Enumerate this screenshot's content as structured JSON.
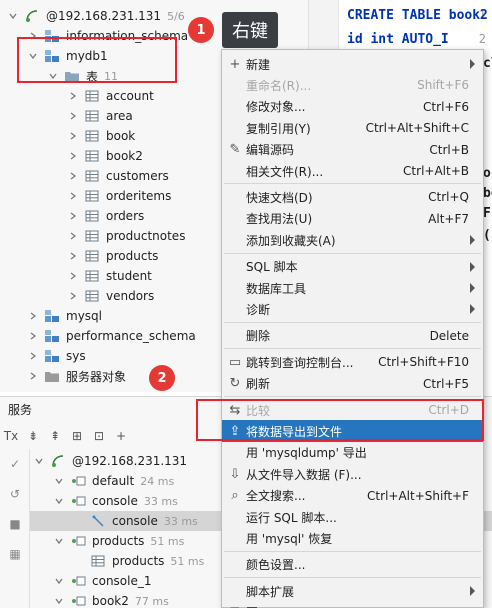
{
  "tree": {
    "connection": {
      "label": "@192.168.231.131",
      "count": "5/6"
    },
    "schemas_top": [
      {
        "label": "information_schema"
      }
    ],
    "mydb": {
      "label": "mydb1"
    },
    "tables_folder": {
      "label": "表",
      "count": "11"
    },
    "tables": [
      "account",
      "area",
      "book",
      "book2",
      "customers",
      "orderitems",
      "orders",
      "productnotes",
      "products",
      "student",
      "vendors"
    ],
    "schemas_bottom": [
      "mysql",
      "performance_schema",
      "sys"
    ],
    "server_objects": "服务器对象"
  },
  "annotations": {
    "badge1": "1",
    "badge2": "2",
    "tooltip": "右键"
  },
  "editor": {
    "lines": [
      {
        "num": "1",
        "text": "CREATE TABLE book2"
      },
      {
        "num": "2",
        "text": "    id int AUTO_I"
      }
    ],
    "fragments": [
      "cl",
      "oc",
      "bo",
      "FI",
      "(I"
    ]
  },
  "services": {
    "title": "服务",
    "toolbar": [
      "Tx",
      "⇟",
      "⇞",
      "⊞",
      "⊡",
      "+"
    ],
    "rows": [
      {
        "label": "@192.168.231.131",
        "time": "",
        "indent": 0,
        "kind": "conn"
      },
      {
        "label": "default",
        "time": "24 ms",
        "indent": 1,
        "kind": "console"
      },
      {
        "label": "console",
        "time": "33 ms",
        "indent": 1,
        "kind": "console"
      },
      {
        "label": "console",
        "time": "33 ms",
        "indent": 2,
        "kind": "console-item",
        "selected": true
      },
      {
        "label": "products",
        "time": "51 ms",
        "indent": 1,
        "kind": "console"
      },
      {
        "label": "products",
        "time": "51 ms",
        "indent": 2,
        "kind": "table"
      },
      {
        "label": "console_1",
        "time": "",
        "indent": 1,
        "kind": "console"
      },
      {
        "label": "book2",
        "time": "77 ms",
        "indent": 1,
        "kind": "console"
      }
    ]
  },
  "menu": {
    "items": [
      {
        "label": "新建",
        "shortcut": "",
        "submenu": true,
        "icon": "plus-icon"
      },
      {
        "label": "重命名(R)...",
        "shortcut": "Shift+F6",
        "disabled": true
      },
      {
        "label": "修改对象...",
        "shortcut": "Ctrl+F6"
      },
      {
        "label": "复制引用(Y)",
        "shortcut": "Ctrl+Alt+Shift+C"
      },
      {
        "label": "编辑源码",
        "shortcut": "Ctrl+B",
        "icon": "edit-icon"
      },
      {
        "label": "相关文件(R)...",
        "shortcut": "Ctrl+Alt+B"
      },
      {
        "sep": true
      },
      {
        "label": "快速文档(D)",
        "shortcut": "Ctrl+Q"
      },
      {
        "label": "查找用法(U)",
        "shortcut": "Alt+F7"
      },
      {
        "label": "添加到收藏夹(A)",
        "shortcut": "",
        "submenu": true
      },
      {
        "sep": true
      },
      {
        "label": "SQL 脚本",
        "shortcut": "",
        "submenu": true
      },
      {
        "label": "数据库工具",
        "shortcut": "",
        "submenu": true
      },
      {
        "label": "诊断",
        "shortcut": "",
        "submenu": true
      },
      {
        "sep": true
      },
      {
        "label": "删除",
        "shortcut": "Delete"
      },
      {
        "sep": true
      },
      {
        "label": "跳转到查询控制台...",
        "shortcut": "Ctrl+Shift+F10",
        "icon": "console-icon"
      },
      {
        "label": "刷新",
        "shortcut": "Ctrl+F5",
        "icon": "refresh-icon"
      },
      {
        "sep": true
      },
      {
        "label": "比较",
        "shortcut": "Ctrl+D",
        "disabled": true,
        "icon": "compare-icon"
      },
      {
        "label": "将数据导出到文件",
        "shortcut": "",
        "active": true,
        "icon": "export-icon"
      },
      {
        "label": "用 'mysqldump' 导出",
        "shortcut": ""
      },
      {
        "label": "从文件导入数据 (F)...",
        "shortcut": "",
        "icon": "import-icon"
      },
      {
        "label": "全文搜索...",
        "shortcut": "Ctrl+Alt+Shift+F",
        "icon": "search-icon"
      },
      {
        "label": "运行 SQL 脚本...",
        "shortcut": ""
      },
      {
        "label": "用 'mysql' 恢复",
        "shortcut": ""
      },
      {
        "sep": true
      },
      {
        "label": "颜色设置...",
        "shortcut": ""
      },
      {
        "sep": true
      },
      {
        "label": "脚本扩展",
        "shortcut": "",
        "submenu": true
      },
      {
        "label": "图",
        "shortcut": "",
        "submenu": true,
        "icon": "diagram-icon"
      }
    ]
  },
  "colors": {
    "highlight_box": "#e8252e",
    "badge": "#e53935",
    "menu_active": "#2675bf",
    "keyword": "#0033b3"
  }
}
